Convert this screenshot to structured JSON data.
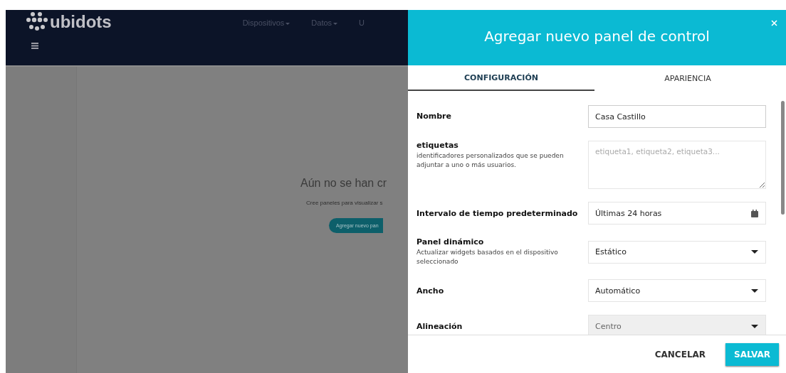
{
  "app": {
    "logo": "ubidots",
    "nav": [
      {
        "label": "Dispositivos",
        "dropdown": true
      },
      {
        "label": "Datos",
        "dropdown": true
      },
      {
        "label": "U",
        "dropdown": false
      }
    ],
    "empty_state": {
      "title": "Aún no se han cr",
      "text": "Cree paneles para visualizar s",
      "button": "Agregar nuevo pan"
    }
  },
  "dialog": {
    "title": "Agregar nuevo panel de control",
    "tabs": [
      {
        "label": "CONFIGURACIÓN",
        "selected": true
      },
      {
        "label": "APARIENCIA",
        "selected": false
      }
    ],
    "fields": [
      {
        "kind": "text",
        "label": "Nombre",
        "value": "Casa Castillo",
        "disabled": false
      },
      {
        "kind": "textarea",
        "label": "etiquetas",
        "help": "identificadores personalizados que se pueden adjuntar a uno o más usuarios.",
        "placeholder": "etiqueta1, etiqueta2, etiqueta3...",
        "disabled": false
      },
      {
        "kind": "date",
        "label": "Intervalo de tiempo predeterminado",
        "value": "Últimas 24 horas",
        "disabled": false
      },
      {
        "kind": "select",
        "label": "Panel dinámico",
        "help": "Actualizar widgets basados en el dispositivo seleccionado",
        "value": "Estático",
        "disabled": false
      },
      {
        "kind": "select",
        "label": "Ancho",
        "value": "Automático",
        "disabled": false
      },
      {
        "kind": "select",
        "label": "Alineación",
        "value": "Centro",
        "disabled": true
      }
    ],
    "buttons": [
      {
        "kind": "flat",
        "label": "CANCELAR"
      },
      {
        "kind": "primary",
        "label": "SALVAR"
      }
    ]
  }
}
